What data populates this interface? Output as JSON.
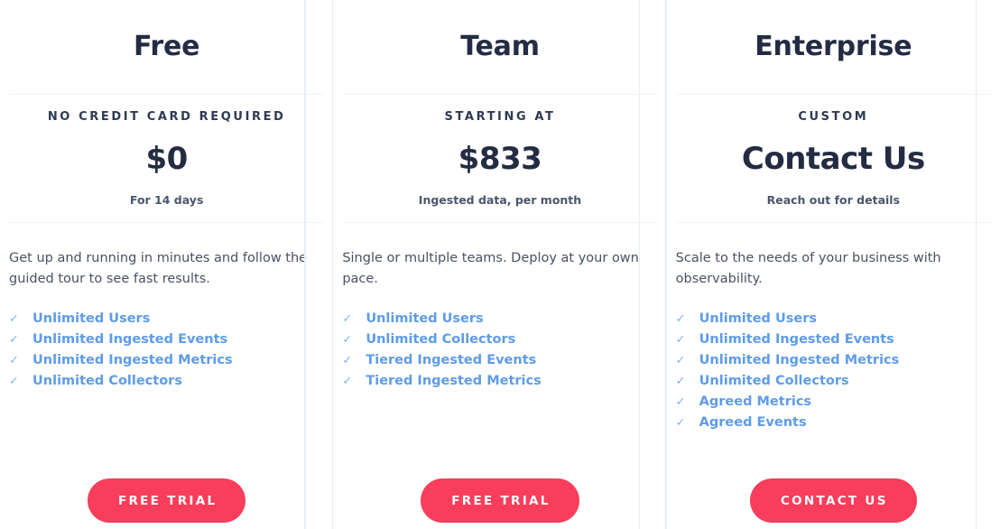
{
  "theme": {
    "accent": "#f93d5c",
    "heading": "#232c43",
    "body_text": "#4a5160",
    "feature_text": "#5e9ce8",
    "check_color": "#7fb4ef",
    "rule_color": "#eef2f8",
    "divider_color": "#e8eef7",
    "background": "#ffffff"
  },
  "plans": [
    {
      "name": "Free",
      "price_label": "NO CREDIT CARD REQUIRED",
      "price_value": "$0",
      "price_note": "For 14 days",
      "description": "Get up and running in minutes and follow the guided tour to see fast results.",
      "check_glyph": "✓",
      "features": [
        "Unlimited Users",
        "Unlimited Ingested Events",
        "Unlimited Ingested Metrics",
        "Unlimited Collectors"
      ],
      "cta_label": "FREE TRIAL"
    },
    {
      "name": "Team",
      "price_label": "STARTING AT",
      "price_value": "$833",
      "price_note": "Ingested data, per month",
      "description": "Single or multiple teams. Deploy at your own pace.",
      "check_glyph": "✓",
      "features": [
        "Unlimited Users",
        "Unlimited Collectors",
        "Tiered Ingested Events",
        "Tiered Ingested Metrics"
      ],
      "cta_label": "FREE TRIAL"
    },
    {
      "name": "Enterprise",
      "price_label": "CUSTOM",
      "price_value": "Contact Us",
      "price_note": "Reach out for details",
      "description": "Scale to the needs of your business with observability.",
      "check_glyph": "✓",
      "features": [
        "Unlimited Users",
        "Unlimited Ingested Events",
        "Unlimited Ingested Metrics",
        "Unlimited Collectors",
        "Agreed Metrics",
        "Agreed Events"
      ],
      "cta_label": "CONTACT US"
    }
  ]
}
